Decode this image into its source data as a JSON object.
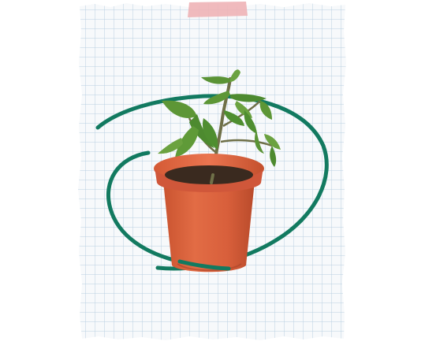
{
  "scene": {
    "description_free": true,
    "elements": [
      "grid-paper",
      "masking-tape",
      "hand-drawn-circle",
      "potted-tomato-seedling"
    ]
  },
  "colors": {
    "background": "#ffffff",
    "paper": "#f7f9fb",
    "grid_line": "#b9cfe0",
    "tape": "#eeb3b6",
    "circle": "#127a60",
    "pot": "#d8603e",
    "pot_shadow": "#b54a2f",
    "soil": "#3a2a1f",
    "stem": "#6f7048",
    "leaf": "#4d8a2f",
    "leaf_light": "#7fae4c"
  }
}
